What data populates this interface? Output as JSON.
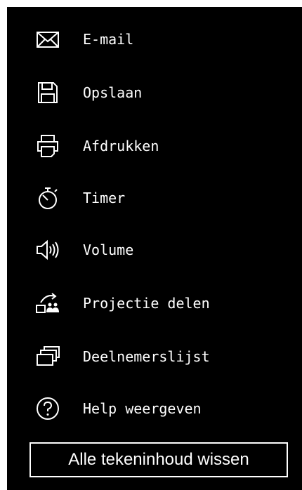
{
  "menu": {
    "items": [
      {
        "label": "E-mail",
        "icon": "mail-icon"
      },
      {
        "label": "Opslaan",
        "icon": "save-icon"
      },
      {
        "label": "Afdrukken",
        "icon": "print-icon"
      },
      {
        "label": "Timer",
        "icon": "timer-icon"
      },
      {
        "label": "Volume",
        "icon": "volume-icon"
      },
      {
        "label": "Projectie delen",
        "icon": "share-projection-icon"
      },
      {
        "label": "Deelnemerslijst",
        "icon": "participant-list-icon"
      },
      {
        "label": "Help weergeven",
        "icon": "help-icon"
      }
    ]
  },
  "footer": {
    "clear_label": "Alle tekeninhoud wissen"
  },
  "colors": {
    "background": "#000000",
    "foreground": "#ffffff"
  }
}
